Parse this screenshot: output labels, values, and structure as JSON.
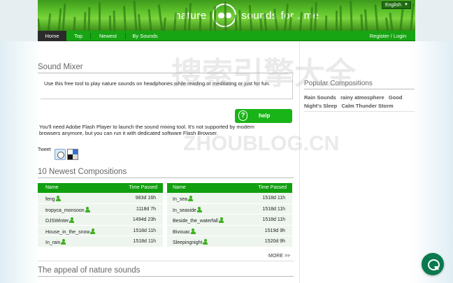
{
  "header": {
    "brand_left": "nature",
    "brand_right": "sounds for . me",
    "language": "English"
  },
  "nav": {
    "items": [
      "Home",
      "Top",
      "Newest",
      "By Sounds"
    ],
    "account": "Register / Login"
  },
  "mixer": {
    "title": "Sound Mixer",
    "intro": "Use this free tool to play nature sounds on headphones while reading or meditating or just for fun.",
    "help_label": "help",
    "flash_note": "You'll need Adobe Flash Player to launch the sound mixing tool. It's not supported by modern browsers anymore, but you can run it with dedicated software Flash Browser.",
    "tweet_label": "Tweet"
  },
  "newest": {
    "title": "10 Newest Compositions",
    "col_name": "Name",
    "col_time": "Time Passed",
    "left": [
      {
        "name": "feng",
        "time": "983d 16h"
      },
      {
        "name": "tropyca_monsoon",
        "time": "1118d 7h"
      },
      {
        "name": "DJSWinter",
        "time": "1494d 23h"
      },
      {
        "name": "House_in_the_snow",
        "time": "1518d 11h"
      },
      {
        "name": "In_rain",
        "time": "1518d 11h"
      }
    ],
    "right": [
      {
        "name": "In_sea",
        "time": "1518d 11h"
      },
      {
        "name": "In_seaside",
        "time": "1518d 11h"
      },
      {
        "name": "Beside_the_waterfall",
        "time": "1518d 11h"
      },
      {
        "name": "Bivouac",
        "time": "1519d 9h"
      },
      {
        "name": "Sleepingnight",
        "time": "1520d 9h"
      }
    ],
    "more_label": "MORE >>"
  },
  "appeal": {
    "title": "The appeal of nature sounds"
  },
  "sidebar": {
    "title": "Popular Compositions",
    "tags_row1": [
      "Rain Sounds",
      "rainy atmosphere",
      "Good"
    ],
    "tags_row2": [
      "Night's Sleep",
      "Calm Thunder Storm"
    ]
  },
  "watermark": {
    "text1": "搜索引擎大全",
    "text2": "ZHOUBLOG.CN"
  },
  "colors": {
    "brand_green": "#17a513",
    "table_header": "#119f0f",
    "chat": "#0a7a4e"
  }
}
